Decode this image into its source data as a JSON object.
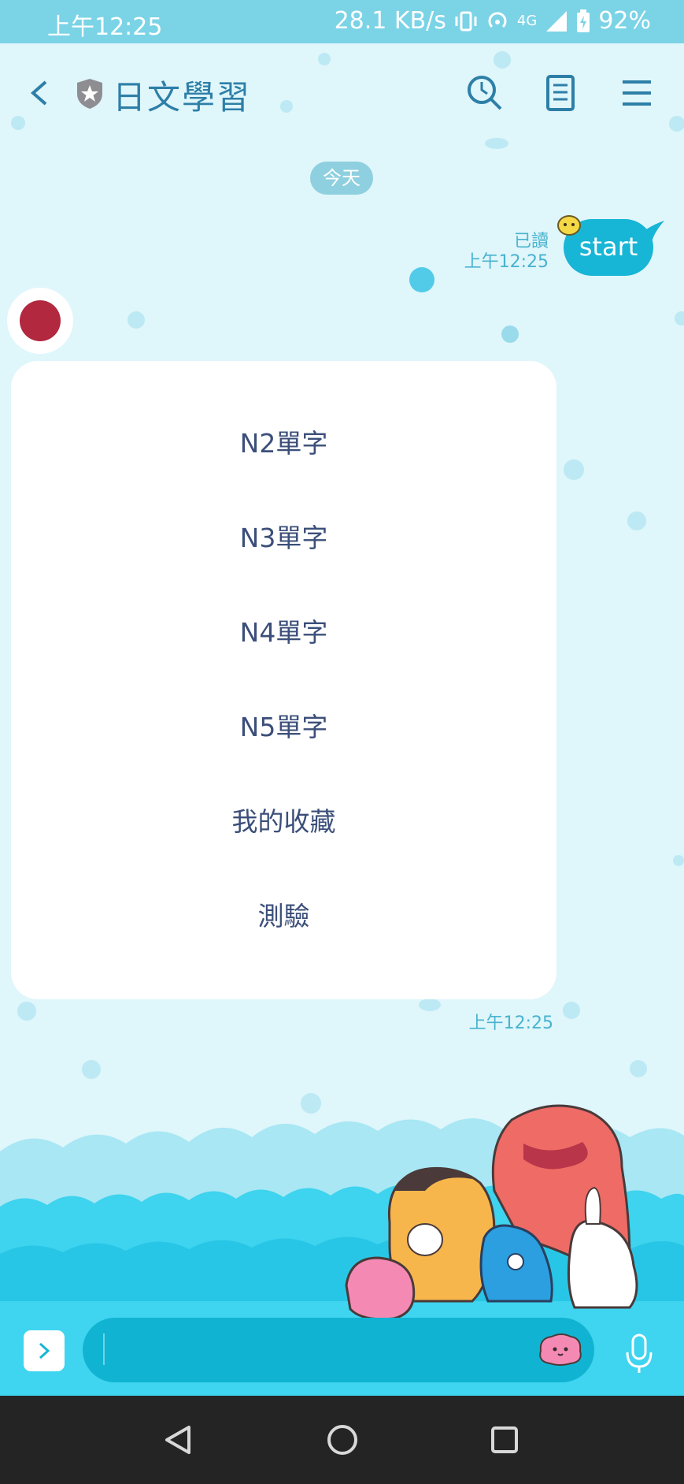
{
  "status_bar": {
    "time": "上午12:25",
    "network_speed": "28.1 KB/s",
    "network_type": "4G",
    "battery": "92%"
  },
  "header": {
    "title": "日文學習",
    "back_icon": "chevron-left-icon",
    "search_icon": "search-icon",
    "notes_icon": "notes-icon",
    "menu_icon": "menu-icon"
  },
  "chat": {
    "date_separator": "今天",
    "sent": {
      "text": "start",
      "read_status": "已讀",
      "time": "上午12:25"
    },
    "bot_card": {
      "options": [
        "N2單字",
        "N3單字",
        "N4單字",
        "N5單字",
        "我的收藏",
        "測驗"
      ],
      "time": "上午12:25"
    }
  },
  "input_bar": {
    "expand_icon": "chevron-right-icon",
    "sticker_icon": "sticker-icon",
    "mic_icon": "microphone-icon"
  },
  "nav_bar": {
    "back": "back-triangle-icon",
    "home": "home-circle-icon",
    "recents": "recents-square-icon"
  },
  "colors": {
    "status_bar": "#7bd3e6",
    "chat_background": "#dff6fb",
    "accent": "#17b5d6",
    "title": "#2d7fa7",
    "menu_text": "#3c4f7a"
  }
}
